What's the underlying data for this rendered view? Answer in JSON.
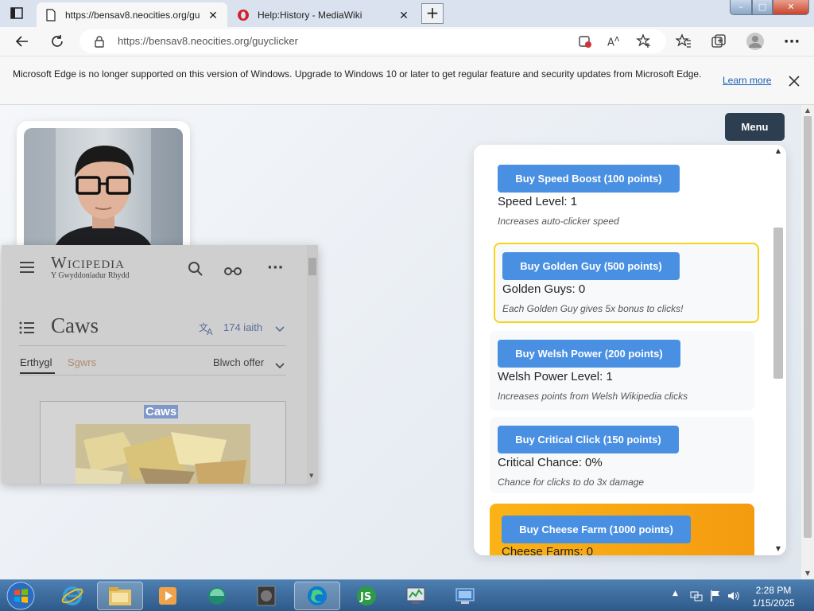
{
  "browser": {
    "tabs": [
      {
        "title": "https://bensav8.neocities.org/gu",
        "active": true
      },
      {
        "title": "Help:History - MediaWiki",
        "active": false
      }
    ],
    "url": "https://bensav8.neocities.org/guyclicker",
    "window_controls": {
      "minimize": "–",
      "maximize": "□",
      "close": "✕"
    },
    "new_tab_label": "+"
  },
  "infobar": {
    "message": "Microsoft Edge is no longer supported on this version of Windows. Upgrade to Windows 10 or later to get regular feature and security updates from Microsoft Edge.",
    "learn_more": "Learn more"
  },
  "game": {
    "menu_label": "Menu",
    "upgrades": [
      {
        "button": "Buy Speed Boost (100 points)",
        "level": "Speed Level: 1",
        "desc": "Increases auto-clicker speed"
      },
      {
        "button": "Buy Golden Guy (500 points)",
        "level": "Golden Guys: 0",
        "desc": "Each Golden Guy gives 5x bonus to clicks!"
      },
      {
        "button": "Buy Welsh Power (200 points)",
        "level": "Welsh Power Level: 1",
        "desc": "Increases points from Welsh Wikipedia clicks"
      },
      {
        "button": "Buy Critical Click (150 points)",
        "level": "Critical Chance: 0%",
        "desc": "Chance for clicks to do 3x damage"
      },
      {
        "button": "Buy Cheese Farm (1000 points)",
        "level": "Cheese Farms: 0",
        "desc": ""
      }
    ]
  },
  "wiki": {
    "logo": "Wicipedia",
    "tagline": "Y Gwyddoniadur Rhydd",
    "title": "Caws",
    "languages": "174 iaith",
    "tab_article": "Erthygl",
    "tab_talk": "Sgwrs",
    "read_menu": "Blwch offer",
    "infobox_title": "Caws"
  },
  "taskbar": {
    "time": "2:28 PM",
    "date": "1/15/2025"
  },
  "colors": {
    "buy_button": "#4a90e2",
    "menu_button": "#2c3e50",
    "golden_border": "#f7d417",
    "cheese_gradient": "#f5a312"
  }
}
